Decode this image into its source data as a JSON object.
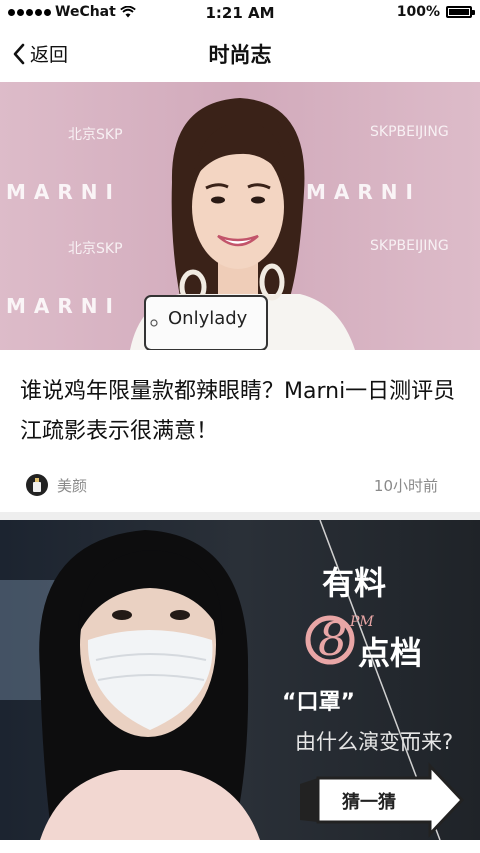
{
  "status_bar": {
    "carrier": "WeChat",
    "time": "1:21 AM",
    "battery_percent": "100%",
    "battery_level": 1.0,
    "signal_icon": "signal-dots-icon",
    "wifi_icon": "wifi-icon"
  },
  "nav": {
    "back_label": "返回",
    "back_icon": "chevron-left-icon",
    "title": "时尚志"
  },
  "cards": [
    {
      "image": {
        "brand_letters": "MARNI",
        "store_cn": "北京SKP",
        "store_en": "SKPBEIJING",
        "badge": "Onlylady"
      },
      "title": "谁说鸡年限量款都辣眼睛？Marni一日测评员江疏影表示很满意！",
      "source": "美颜",
      "time": "10小时前"
    },
    {
      "image": {
        "brand_line1": "有料",
        "brand_line2_num": "8",
        "brand_line2_pm": "PM",
        "brand_line2_text": "点档",
        "quote": "“口罩”",
        "subtitle": "由什么演变而来?",
        "button": "猜一猜"
      }
    }
  ],
  "colors": {
    "nav_text": "#111111",
    "meta_text": "#8a8a8a",
    "separator": "#eeeeee",
    "card1_bg": "#d8b1c0",
    "card2_bg": "#2a2e33",
    "accent_pink": "#e9a6a6"
  }
}
